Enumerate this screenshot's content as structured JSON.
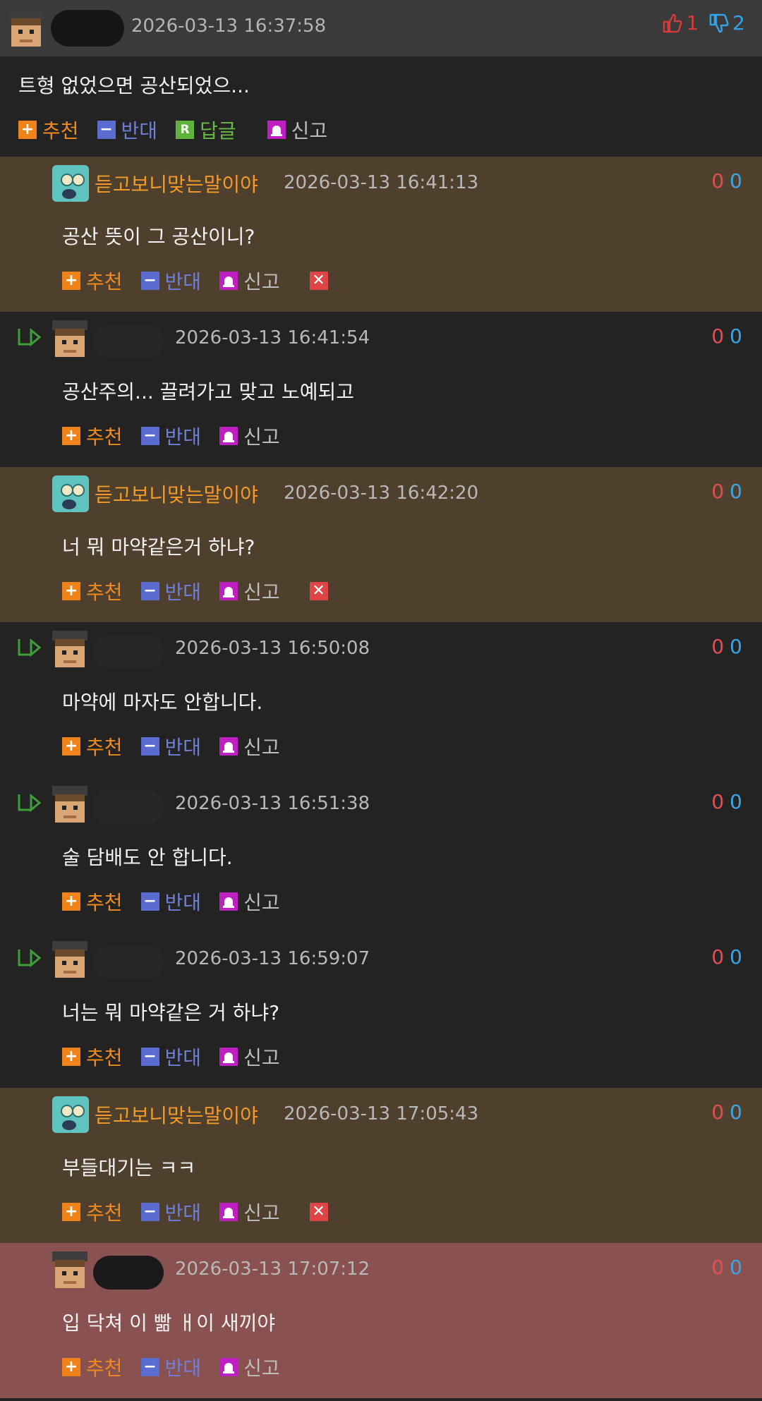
{
  "top_post": {
    "timestamp": "2026-03-13 16:37:58",
    "upvotes": "1",
    "downvotes": "2",
    "text": "트형 없었으면 공산되었으...",
    "actions": {
      "recommend": "추천",
      "oppose": "반대",
      "reply": "답글",
      "report": "신고"
    }
  },
  "labels": {
    "recommend": "추천",
    "oppose": "반대",
    "report": "신고"
  },
  "comments": [
    {
      "style": "brown",
      "reply": false,
      "avatar": "squid-avatar",
      "name": "듣고보니맞는말이야",
      "timestamp": "2026-03-13 16:41:13",
      "up": "0",
      "down": "0",
      "text": "공산 뜻이 그 공산이니?",
      "delete": true
    },
    {
      "style": "dark",
      "reply": true,
      "avatar": "user-avatar",
      "name": "",
      "timestamp": "2026-03-13 16:41:54",
      "up": "0",
      "down": "0",
      "text": "공산주의... 끌려가고 맞고 노예되고",
      "delete": false
    },
    {
      "style": "brown",
      "reply": false,
      "avatar": "squid-avatar",
      "name": "듣고보니맞는말이야",
      "timestamp": "2026-03-13 16:42:20",
      "up": "0",
      "down": "0",
      "text": "너 뭐 마약같은거 하냐?",
      "delete": true
    },
    {
      "style": "dark",
      "reply": true,
      "avatar": "user-avatar",
      "name": "",
      "timestamp": "2026-03-13 16:50:08",
      "up": "0",
      "down": "0",
      "text": "마약에 마자도 안합니다.",
      "delete": false
    },
    {
      "style": "dark",
      "reply": true,
      "avatar": "user-avatar",
      "name": "",
      "timestamp": "2026-03-13 16:51:38",
      "up": "0",
      "down": "0",
      "text": "술 담배도 안 합니다.",
      "delete": false
    },
    {
      "style": "dark",
      "reply": true,
      "avatar": "user-avatar",
      "name": "",
      "timestamp": "2026-03-13 16:59:07",
      "up": "0",
      "down": "0",
      "text": "너는 뭐 마약같은 거 하냐?",
      "delete": false
    },
    {
      "style": "brown",
      "reply": false,
      "avatar": "squid-avatar",
      "name": "듣고보니맞는말이야",
      "timestamp": "2026-03-13 17:05:43",
      "up": "0",
      "down": "0",
      "text": "부들대기는 ㅋㅋ",
      "delete": true
    },
    {
      "style": "red",
      "reply": false,
      "avatar": "user-avatar",
      "name": "",
      "timestamp": "2026-03-13 17:07:12",
      "up": "0",
      "down": "0",
      "text": "입 닥쳐 이 빪 ㅐ이 새끼야",
      "delete": false
    }
  ]
}
